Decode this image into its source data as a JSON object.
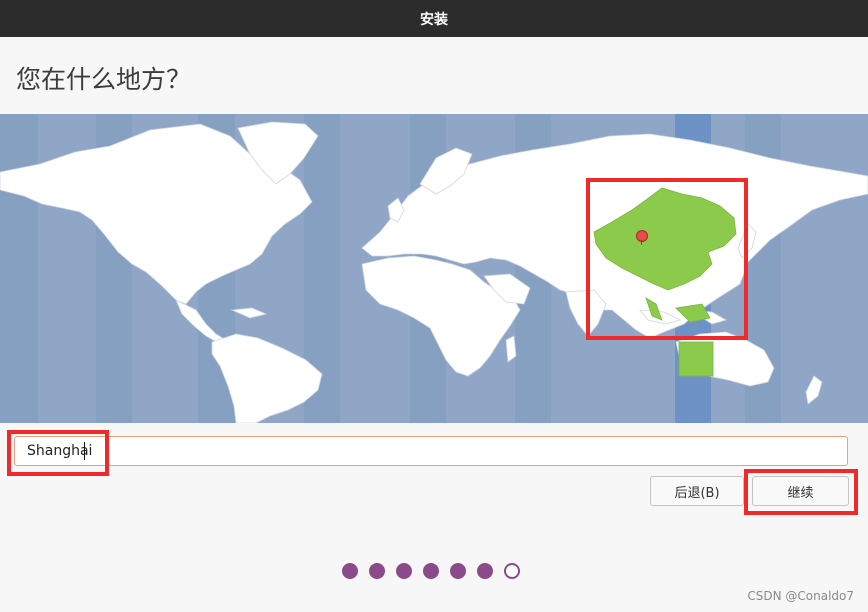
{
  "window": {
    "title": "安装"
  },
  "page": {
    "title": "您在什么地方？"
  },
  "map": {
    "ocean_color": "#8fa6c6",
    "land_color": "#ffffff",
    "selected_zone_color": "#8cca4c",
    "highlight_band_color": "#6f92c6",
    "marker_color": "#e94a4a",
    "annotation_color": "#ee2a2a"
  },
  "timezone": {
    "value": "Shanghai",
    "placeholder": ""
  },
  "buttons": {
    "back": "后退(B)",
    "continue": "继续"
  },
  "progress": {
    "total_steps": 7,
    "current_step": 7
  },
  "watermark": "CSDN @Conaldo7"
}
